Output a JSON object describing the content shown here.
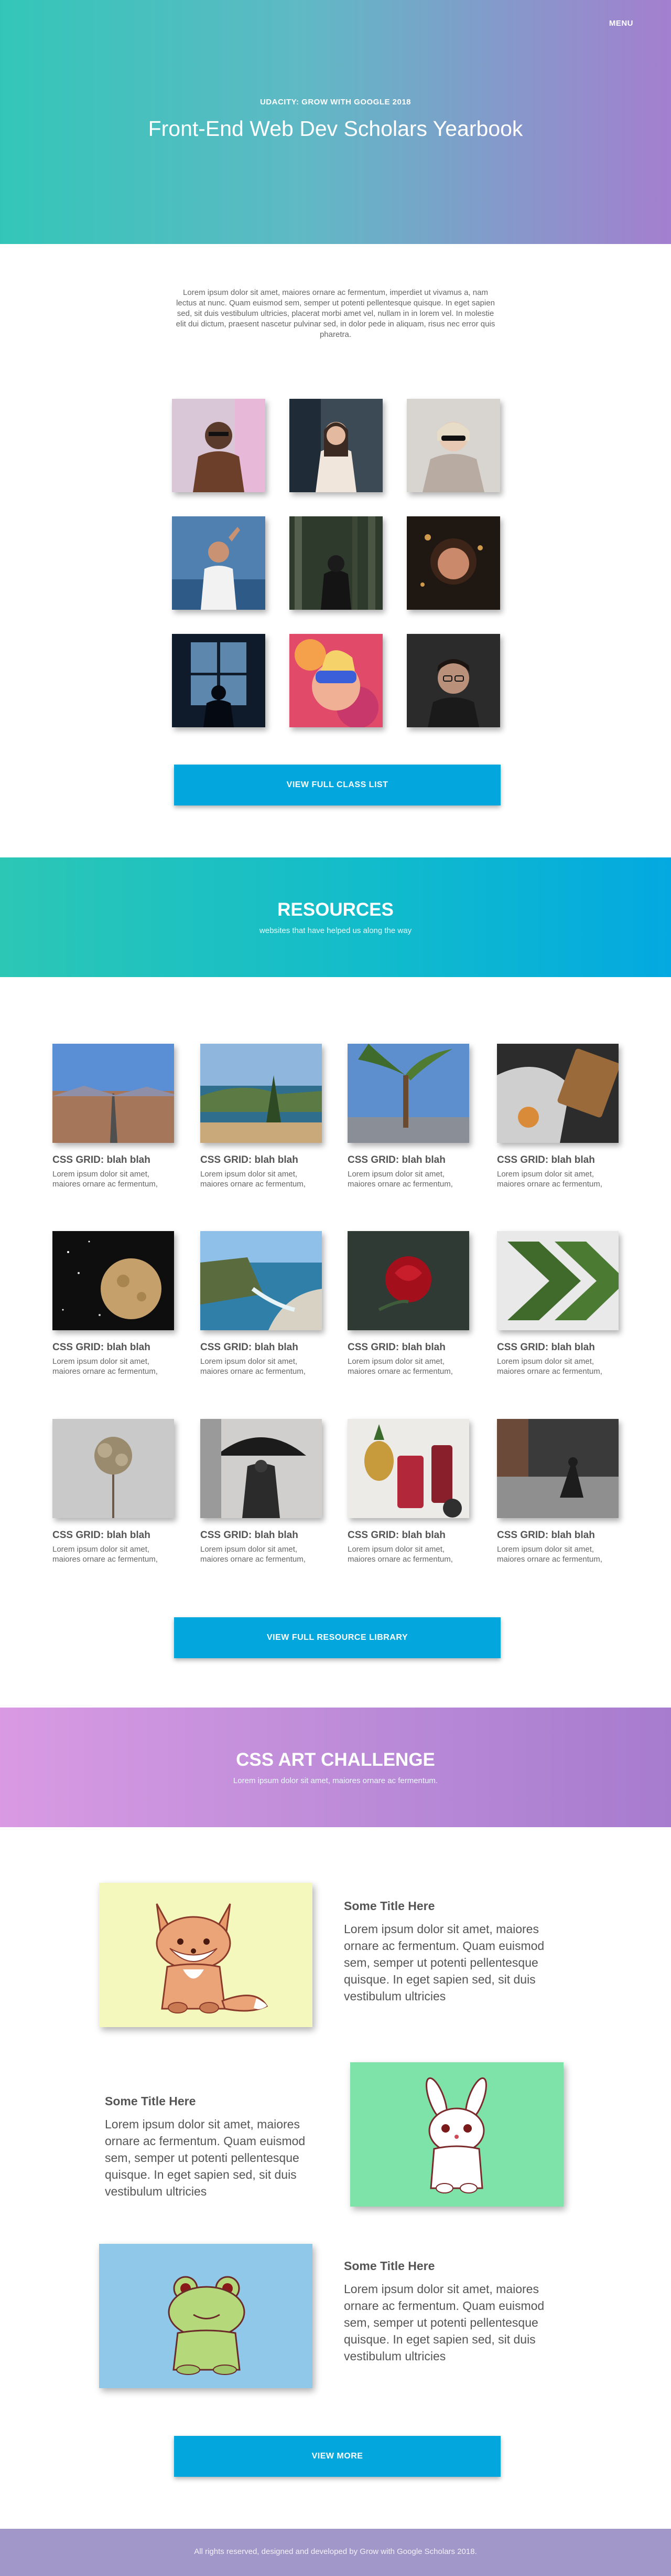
{
  "header": {
    "menu_label": "MENU",
    "kicker": "UDACITY: GROW WITH GOOGLE 2018",
    "title": "Front-End Web Dev Scholars Yearbook"
  },
  "intro": {
    "text": "Lorem ipsum dolor sit amet, maiores ornare ac fermentum, imperdiet ut vivamus a, nam lectus at nunc. Quam euismod sem, semper ut potenti pellentesque quisque. In eget sapien sed, sit duis vestibulum ultricies, placerat morbi amet vel, nullam in in lorem vel. In molestie elit dui dictum, praesent nascetur pulvinar sed, in dolor pede in aliquam, risus nec error quis pharetra."
  },
  "people": [
    {
      "name": "student-photo-1"
    },
    {
      "name": "student-photo-2"
    },
    {
      "name": "student-photo-3"
    },
    {
      "name": "student-photo-4"
    },
    {
      "name": "student-photo-5"
    },
    {
      "name": "student-photo-6"
    },
    {
      "name": "student-photo-7"
    },
    {
      "name": "student-photo-8"
    },
    {
      "name": "student-photo-9"
    }
  ],
  "class_list_button": "VIEW FULL CLASS LIST",
  "resources": {
    "title": "RESOURCES",
    "subtitle": "websites that have helped us along the way",
    "cards": [
      {
        "title": "CSS GRID: blah blah",
        "desc": "Lorem ipsum dolor sit amet, maiores ornare ac fermentum,"
      },
      {
        "title": "CSS GRID: blah blah",
        "desc": "Lorem ipsum dolor sit amet, maiores ornare ac fermentum,"
      },
      {
        "title": "CSS GRID: blah blah",
        "desc": "Lorem ipsum dolor sit amet, maiores ornare ac fermentum,"
      },
      {
        "title": "CSS GRID: blah blah",
        "desc": "Lorem ipsum dolor sit amet, maiores ornare ac fermentum,"
      },
      {
        "title": "CSS GRID: blah blah",
        "desc": "Lorem ipsum dolor sit amet, maiores ornare ac fermentum,"
      },
      {
        "title": "CSS GRID: blah blah",
        "desc": "Lorem ipsum dolor sit amet, maiores ornare ac fermentum,"
      },
      {
        "title": "CSS GRID: blah blah",
        "desc": "Lorem ipsum dolor sit amet, maiores ornare ac fermentum,"
      },
      {
        "title": "CSS GRID: blah blah",
        "desc": "Lorem ipsum dolor sit amet, maiores ornare ac fermentum,"
      },
      {
        "title": "CSS GRID: blah blah",
        "desc": "Lorem ipsum dolor sit amet, maiores ornare ac fermentum,"
      },
      {
        "title": "CSS GRID: blah blah",
        "desc": "Lorem ipsum dolor sit amet, maiores ornare ac fermentum,"
      },
      {
        "title": "CSS GRID: blah blah",
        "desc": "Lorem ipsum dolor sit amet, maiores ornare ac fermentum,"
      },
      {
        "title": "CSS GRID: blah blah",
        "desc": "Lorem ipsum dolor sit amet, maiores ornare ac fermentum,"
      }
    ],
    "button": "VIEW FULL RESOURCE LIBRARY"
  },
  "art": {
    "title": "CSS ART CHALLENGE",
    "subtitle": "Lorem ipsum dolor sit amet, maiores ornare ac fermentum.",
    "items": [
      {
        "title": "Some Title Here",
        "desc": "Lorem ipsum dolor sit amet, maiores ornare ac fermentum. Quam euismod sem, semper ut potenti pellentesque quisque. In eget sapien sed, sit duis vestibulum ultricies",
        "bg": "#f5f8bd",
        "icon": "fox-icon"
      },
      {
        "title": "Some Title Here",
        "desc": "Lorem ipsum dolor sit amet, maiores ornare ac fermentum. Quam euismod sem, semper ut potenti pellentesque quisque. In eget sapien sed, sit duis vestibulum ultricies",
        "bg": "#7ee3a8",
        "icon": "bunny-icon"
      },
      {
        "title": "Some Title Here",
        "desc": "Lorem ipsum dolor sit amet, maiores ornare ac fermentum. Quam euismod sem, semper ut potenti pellentesque quisque. In eget sapien sed, sit duis vestibulum ultricies",
        "bg": "#8fc8e8",
        "icon": "frog-icon"
      }
    ],
    "button": "VIEW MORE"
  },
  "footer": {
    "text": "All rights reserved, designed and developed by Grow with Google Scholars 2018."
  }
}
